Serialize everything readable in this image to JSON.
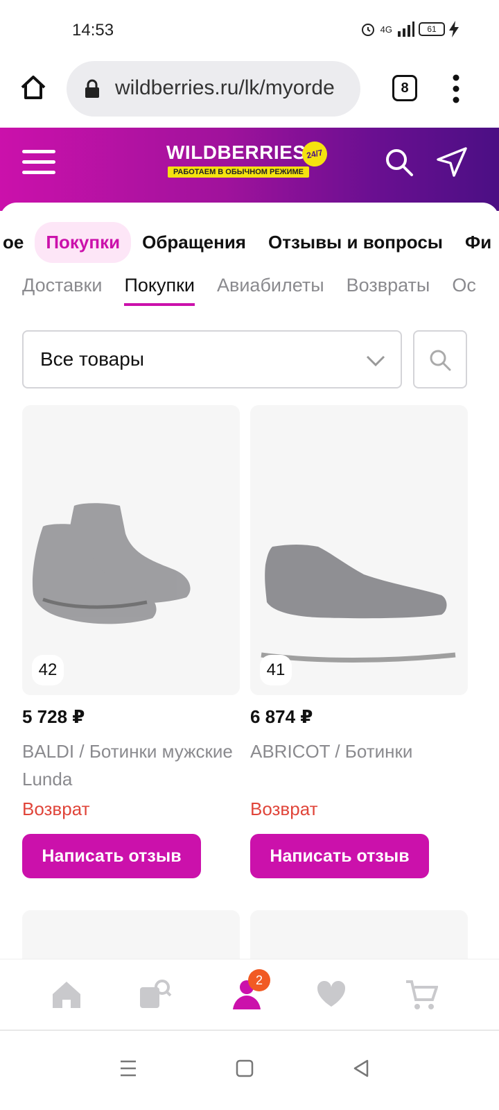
{
  "status_bar": {
    "time": "14:53",
    "network": "4G",
    "battery": "61"
  },
  "browser": {
    "url": "wildberries.ru/lk/myorde",
    "tab_count": "8"
  },
  "header": {
    "logo": "WILDBERRIES",
    "logo_badge": "24/7",
    "logo_tagline": "РАБОТАЕМ В ОБЫЧНОМ РЕЖИМЕ"
  },
  "main_tabs": [
    "ое",
    "Покупки",
    "Обращения",
    "Отзывы и вопросы",
    "Фи"
  ],
  "sub_tabs": [
    "Доставки",
    "Покупки",
    "Авиабилеты",
    "Возвраты",
    "Ос"
  ],
  "filter": {
    "selected": "Все товары"
  },
  "products": [
    {
      "size": "42",
      "price": "5 728 ₽",
      "title": "BALDI / Ботинки мужские Lunda",
      "status": "Возврат",
      "button": "Написать отзыв"
    },
    {
      "size": "41",
      "price": "6 874 ₽",
      "title": "ABRICOT / Ботинки",
      "status": "Возврат",
      "button": "Написать отзыв"
    }
  ],
  "bottom_nav": {
    "profile_badge": "2"
  },
  "colors": {
    "brand": "#cb11ab",
    "brand_dark": "#4b0f84",
    "status_return": "#e0453a",
    "badge": "#f15a24"
  }
}
